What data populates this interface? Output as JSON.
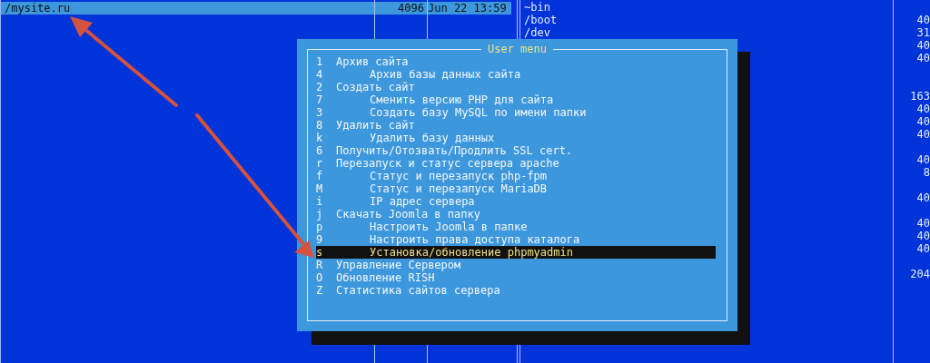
{
  "left_panel": {
    "selected_row": {
      "name": "/mysite.ru",
      "size": "4096",
      "modified": "Jun 22 13:59"
    }
  },
  "right_panel": {
    "rows": [
      {
        "name": "~bin"
      },
      {
        "name": "/boot",
        "size": "40"
      },
      {
        "name": "/dev",
        "size": "31"
      },
      {
        "size": "40"
      },
      {
        "size": "40"
      },
      {},
      {},
      {
        "size": "163"
      },
      {
        "size": "40"
      },
      {
        "size": "40"
      },
      {
        "size": "40"
      },
      {},
      {
        "size": "40"
      },
      {
        "size": "8"
      },
      {},
      {
        "size": "40"
      },
      {},
      {
        "size": "40"
      },
      {
        "size": "40"
      },
      {
        "size": "40"
      },
      {},
      {
        "size": "204"
      }
    ]
  },
  "dialog": {
    "title": "User menu",
    "items": [
      {
        "key": "1",
        "label": "Архив сайта",
        "selected": false,
        "children": [
          {
            "key": "4",
            "label": "Архив базы данных сайта",
            "selected": false
          }
        ]
      },
      {
        "key": "2",
        "label": "Создать сайт",
        "selected": false,
        "children": [
          {
            "key": "7",
            "label": "Сменить версию PHP для сайта",
            "selected": false
          },
          {
            "key": "3",
            "label": "Создать базу MySQL по имени папки",
            "selected": false
          }
        ]
      },
      {
        "key": "8",
        "label": "Удалить сайт",
        "selected": false,
        "children": [
          {
            "key": "k",
            "label": "Удалить базу данных",
            "selected": false
          }
        ]
      },
      {
        "key": "6",
        "label": "Получить/Отозвать/Продлить SSL cert.",
        "selected": false
      },
      {
        "key": "r",
        "label": "Перезапуск и статус сервера apache",
        "selected": false,
        "children": [
          {
            "key": "f",
            "label": "Статус и перезапуск php-fpm",
            "selected": false
          },
          {
            "key": "M",
            "label": "Статус и перезапуск MariaDB",
            "selected": false
          },
          {
            "key": "i",
            "label": "IP адрес сервера",
            "selected": false
          }
        ]
      },
      {
        "key": "j",
        "label": "Скачать Joomla в папку",
        "selected": false,
        "children": [
          {
            "key": "p",
            "label": "Настроить Joomla в папке",
            "selected": false
          },
          {
            "key": "9",
            "label": "Настроить права доступа каталога",
            "selected": false
          },
          {
            "key": "s",
            "label": "Установка/обновление phpmyadmin",
            "selected": true
          }
        ]
      },
      {
        "key": "R",
        "label": "Управление Сервером",
        "selected": false
      },
      {
        "key": "O",
        "label": "Обновление RISH",
        "selected": false
      },
      {
        "key": "Z",
        "label": "Статистика сайтов сервера",
        "selected": false
      }
    ]
  }
}
